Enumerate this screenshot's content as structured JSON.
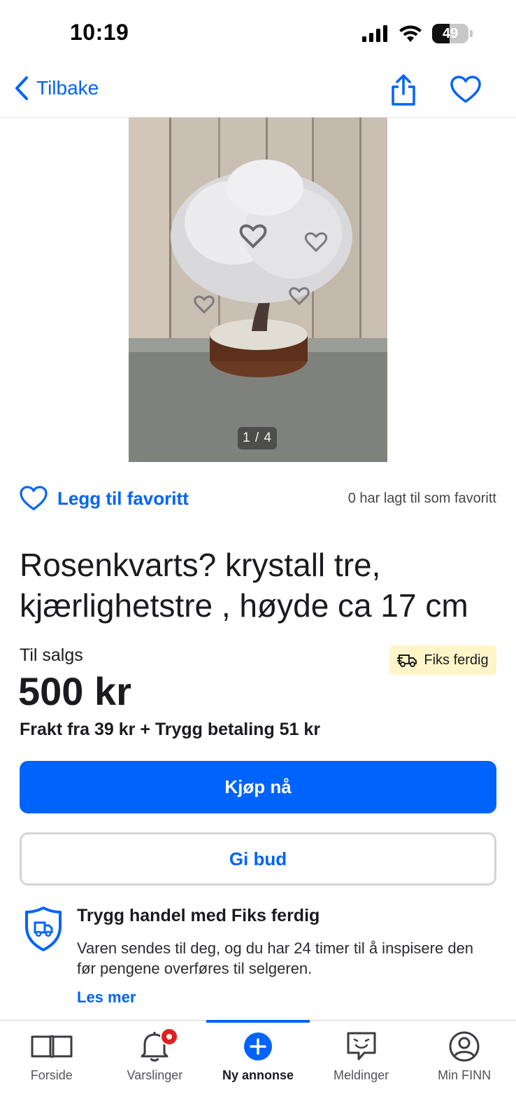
{
  "status_bar": {
    "time": "10:19",
    "battery_level": "49",
    "battery_fraction": 0.49
  },
  "nav": {
    "back_label": "Tilbake",
    "share_icon": "share-icon",
    "favorite_icon": "heart-outline-icon"
  },
  "listing": {
    "image_counter": "1 / 4",
    "favorite_label": "Legg til favoritt",
    "favorite_count_text": "0 har lagt til som favoritt",
    "title": "Rosenkvarts? krystall tre, kjærlighetstre , høyde ca 17 cm",
    "status_label": "Til salgs",
    "badge_label": "Fiks ferdig",
    "price": "500 kr",
    "shipping_text": "Frakt fra 39 kr + Trygg betaling 51 kr",
    "buy_label": "Kjøp nå",
    "bid_label": "Gi bud"
  },
  "safe_trade": {
    "title": "Trygg handel med Fiks ferdig",
    "text": "Varen sendes til deg, og du har 24 timer til å inspisere den før pengene overføres til selgeren.",
    "link": "Les mer"
  },
  "tabs": [
    {
      "label": "Forside",
      "icon": "book-icon"
    },
    {
      "label": "Varslinger",
      "icon": "bell-icon"
    },
    {
      "label": "Ny annonse",
      "icon": "plus-circle-icon",
      "active": true
    },
    {
      "label": "Meldinger",
      "icon": "chat-icon"
    },
    {
      "label": "Min FINN",
      "icon": "profile-icon"
    }
  ],
  "colors": {
    "accent": "#0063fb",
    "badge_bg": "#fff5c8",
    "notification": "#e02020"
  }
}
